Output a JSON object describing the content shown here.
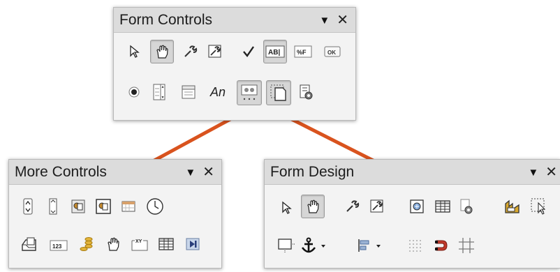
{
  "panels": {
    "form_controls": {
      "title": "Form Controls",
      "tools_row1": [
        "select-icon",
        "design-mode-hand-icon",
        "control-properties-icon",
        "form-properties-icon",
        "check-box-icon",
        "text-box-icon",
        "formatted-field-icon",
        "push-button-icon"
      ],
      "tools_row2": [
        "option-button-icon",
        "list-box-icon",
        "combo-box-icon",
        "label-field-icon",
        "more-controls-icon",
        "form-design-icon",
        "wizards-icon"
      ],
      "text_box_label": "AB|",
      "formatted_field_label": "%F",
      "push_button_label": "OK",
      "label_field_label": "An"
    },
    "more_controls": {
      "title": "More Controls",
      "tools_row1": [
        "spin-button-icon",
        "scrollbar-icon",
        "image-button-icon",
        "image-control-icon",
        "date-field-icon",
        "time-field-icon"
      ],
      "tools_row2": [
        "file-selection-icon",
        "numerical-field-icon",
        "currency-field-icon",
        "pattern-field-icon",
        "group-box-icon",
        "table-control-icon",
        "navigation-bar-icon"
      ],
      "numerical_field_label": "123",
      "pattern_field_label": "XY"
    },
    "form_design": {
      "title": "Form Design",
      "tools_row1": [
        "select-icon",
        "design-mode-hand-icon",
        "control-properties-icon",
        "form-properties-icon",
        "form-navigator-icon",
        "activation-order-icon",
        "open-in-design-mode-icon",
        "automatic-control-focus-icon",
        "add-field-icon"
      ],
      "tools_row2": [
        "position-and-size-icon",
        "anchor-icon",
        "alignment-icon",
        "display-grid-icon",
        "snap-to-grid-icon",
        "guides-when-moving-icon"
      ]
    }
  },
  "window_controls": {
    "menu_glyph": "▼",
    "close_glyph": "✕"
  },
  "colors": {
    "connector": "#d9531e",
    "panel_bg": "#f3f3f3",
    "titlebar_bg": "#dcdcdc"
  }
}
